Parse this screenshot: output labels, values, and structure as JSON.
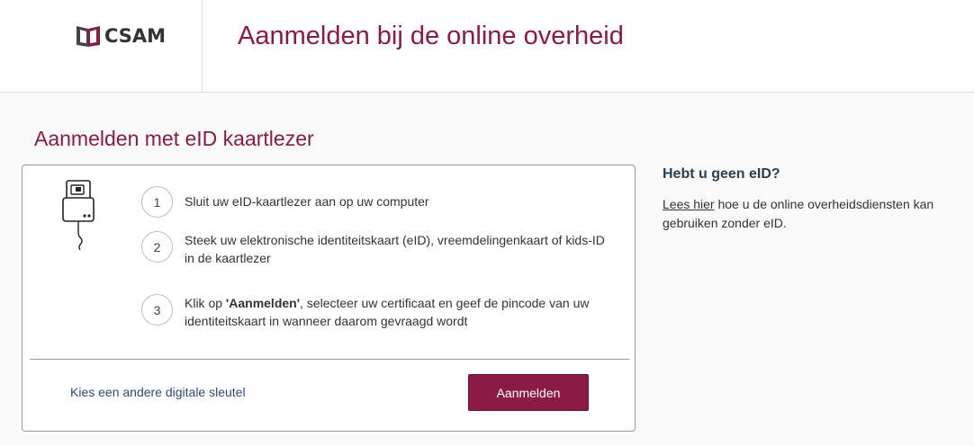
{
  "header": {
    "logo_text": "CSAM",
    "title": "Aanmelden bij de online overheid"
  },
  "main": {
    "title": "Aanmelden met eID kaartlezer",
    "steps": [
      {
        "number": "1",
        "text": "Sluit uw eID-kaartlezer aan op uw computer"
      },
      {
        "number": "2",
        "text": "Steek uw elektronische identiteitskaart (eID), vreemdelingenkaart of kids-ID in de kaartlezer"
      },
      {
        "number": "3",
        "text_bold": "'Aanmelden'",
        "text_prefix": "Klik op ",
        "text_suffix": ", selecteer uw certificaat en geef de pincode van uw identiteitskaart in wanneer daarom gevraagd wordt"
      }
    ],
    "alt_link": "Kies een andere digitale sleutel",
    "login_button": "Aanmelden",
    "icon": "card-reader-icon"
  },
  "side": {
    "title": "Hebt u geen eID?",
    "link_text": "Lees hier",
    "text": " hoe u de online overheidsdiensten kan gebruiken zonder eID."
  },
  "colors": {
    "brand": "#8b1a45",
    "link": "#2d4a7a"
  }
}
